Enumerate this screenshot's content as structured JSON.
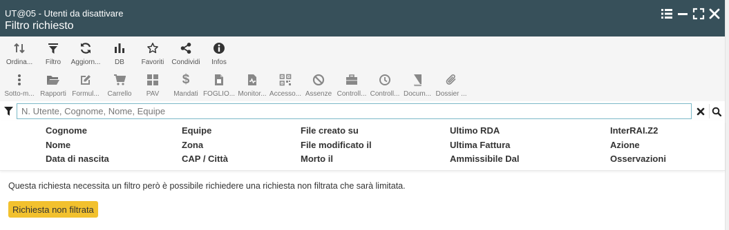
{
  "window": {
    "subtitle": "UT@05 - Utenti da disattivare",
    "title": "Filtro richiesto"
  },
  "toolbar1": [
    {
      "label": "Ordina...",
      "icon": "sort-icon"
    },
    {
      "label": "Filtro",
      "icon": "filter-icon"
    },
    {
      "label": "Aggiorn...",
      "icon": "refresh-icon"
    },
    {
      "label": "DB",
      "icon": "bar-chart-icon"
    },
    {
      "label": "Favoriti",
      "icon": "star-icon"
    },
    {
      "label": "Condividi",
      "icon": "share-icon"
    },
    {
      "label": "Infos",
      "icon": "info-icon"
    }
  ],
  "toolbar2": [
    {
      "label": "Sotto-m...",
      "icon": "vertical-dots-icon"
    },
    {
      "label": "Rapporti",
      "icon": "folder-open-icon"
    },
    {
      "label": "Formul...",
      "icon": "edit-icon"
    },
    {
      "label": "Carrello",
      "icon": "cart-icon"
    },
    {
      "label": "PAV",
      "icon": "grid-icon"
    },
    {
      "label": "Mandati",
      "icon": "dollar-icon"
    },
    {
      "label": "FOGLIO...",
      "icon": "sheet-icon"
    },
    {
      "label": "Monitor...",
      "icon": "monitor-file-icon"
    },
    {
      "label": "Accesso...",
      "icon": "qr-icon"
    },
    {
      "label": "Assenze",
      "icon": "ban-icon"
    },
    {
      "label": "Controll...",
      "icon": "briefcase-icon"
    },
    {
      "label": "Controll...",
      "icon": "clock-icon"
    },
    {
      "label": "Docum...",
      "icon": "book-icon"
    },
    {
      "label": "Dossier ...",
      "icon": "paperclip-icon"
    }
  ],
  "filter": {
    "placeholder": "N. Utente, Cognome, Nome, Equipe",
    "value": ""
  },
  "columns": [
    [
      "Cognome",
      "Nome",
      "Data di nascita"
    ],
    [
      "Equipe",
      "Zona",
      "CAP / Città"
    ],
    [
      "File creato su",
      "File modificato il",
      "Morto il"
    ],
    [
      "Ultimo RDA",
      "Ultima Fattura",
      "Ammissibile Dal"
    ],
    [
      "InterRAI.Z2",
      "Azione",
      "Osservazioni"
    ]
  ],
  "notice": "Questa richiesta necessita un filtro però è possibile richiedere una richiesta non filtrata che sarà limitata.",
  "unfiltered_button": "Richiesta non filtrata",
  "colors": {
    "titlebar": "#37505a",
    "toolbar_bg": "#f5f5f5",
    "input_border": "#7ab8c7",
    "button_yellow": "#f2c12e"
  }
}
